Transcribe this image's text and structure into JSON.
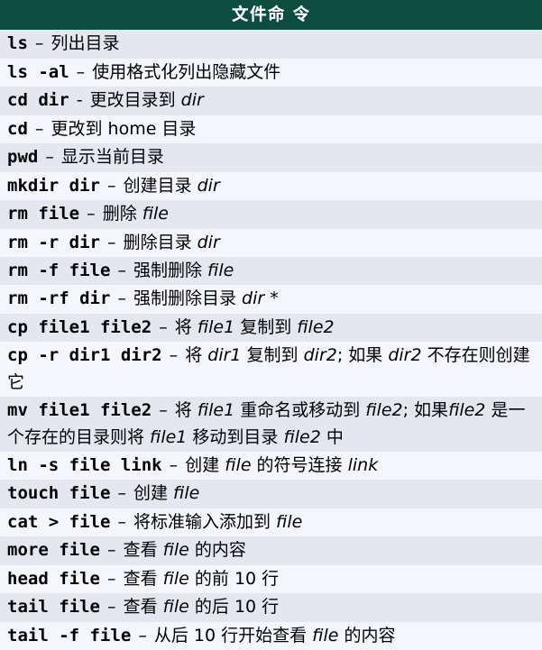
{
  "header": "文件命 令",
  "rows": [
    {
      "cmd": "ls",
      "sep": "–",
      "desc": "列出目录"
    },
    {
      "cmd": "ls -al",
      "sep": "–",
      "desc": "使用格式化列出隐藏文件"
    },
    {
      "cmd": "cd <i>dir</i>",
      "sep": "-",
      "desc": "更改目录到 <i>dir</i>"
    },
    {
      "cmd": "cd",
      "sep": "–",
      "desc": "更改到 home 目录"
    },
    {
      "cmd": "pwd",
      "sep": "–",
      "desc": "显示当前目录"
    },
    {
      "cmd": "mkdir <i>dir</i>",
      "sep": "–",
      "desc": "创建目录 <i>dir</i>"
    },
    {
      "cmd": "rm <i>file</i>",
      "sep": "–",
      "desc": "删除 <i>file</i>"
    },
    {
      "cmd": "rm -r <i>dir</i>",
      "sep": "–",
      "desc": "删除目录 <i>dir</i>"
    },
    {
      "cmd": "rm -f <i>file</i>",
      "sep": "–",
      "desc": "强制删除 <i>file</i>"
    },
    {
      "cmd": "rm -rf <i>dir</i>",
      "sep": "–",
      "desc": "强制删除目录 <i>dir</i> *"
    },
    {
      "cmd": "cp <i>file1</i> <i>file2</i>",
      "sep": "–",
      "desc": "将 <i>file1</i> 复制到 <i>file2</i>"
    },
    {
      "cmd": "cp -r <i>dir1</i> <i>dir2</i>",
      "sep": "–",
      "desc": "将 <i>dir1</i> 复制到 <i>dir2</i>; 如果 <i>dir2</i> 不存在则创建它"
    },
    {
      "cmd": "mv <i>file1</i> <i>file2</i>",
      "sep": "–",
      "desc": "将 <i>file1</i> 重命名或移动到 <i>file2</i>; 如果<i>file2</i> 是一个存在的目录则将 <i>file1</i> 移动到目录 <i>file2</i> 中"
    },
    {
      "cmd": "ln -s <i>file</i> <i>link</i>",
      "sep": "–",
      "desc": "创建 <i>file</i> 的符号连接 <i>link</i>"
    },
    {
      "cmd": "touch <i>file</i>",
      "sep": "–",
      "desc": "创建 <i>file</i>"
    },
    {
      "cmd": "cat > <i>file</i>",
      "sep": "–",
      "desc": "将标准输入添加到 <i>file</i>"
    },
    {
      "cmd": "more <i>file</i>",
      "sep": "–",
      "desc": "查看 <i>file</i> 的内容"
    },
    {
      "cmd": "head <i>file</i>",
      "sep": "–",
      "desc": "查看 <i>file</i> 的前 10 行"
    },
    {
      "cmd": "tail <i>file</i>",
      "sep": "–",
      "desc": "查看 <i>file</i> 的后 10 行"
    },
    {
      "cmd": "tail -f <i>file</i>",
      "sep": "–",
      "desc": "从后 10 行开始查看 <i>file</i> 的内容"
    }
  ]
}
